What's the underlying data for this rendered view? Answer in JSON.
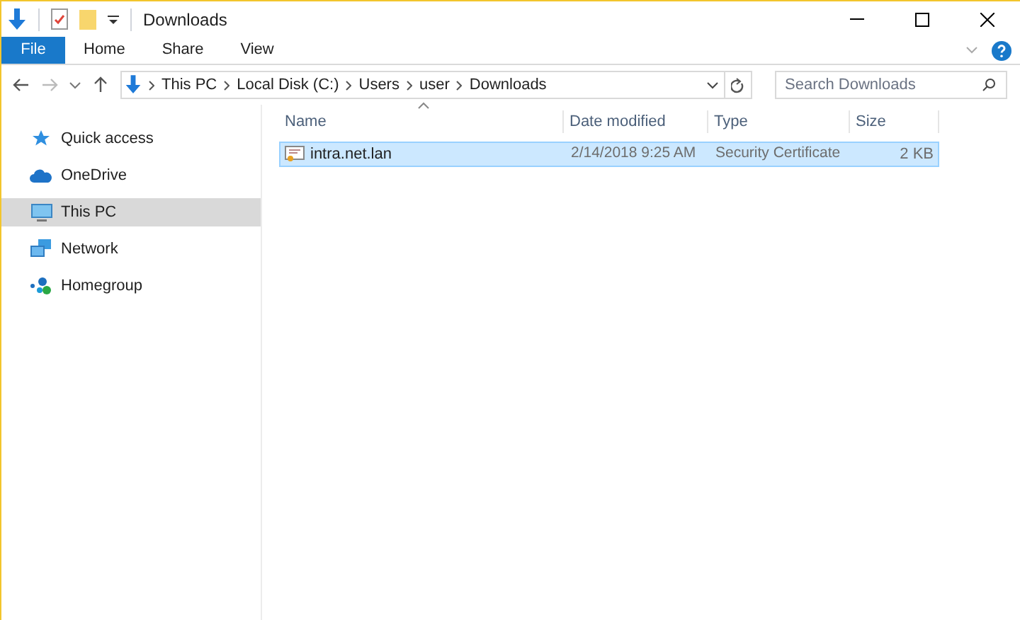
{
  "window": {
    "title": "Downloads"
  },
  "ribbon_tabs": [
    {
      "label": "File",
      "kind": "file"
    },
    {
      "label": "Home",
      "kind": "tab"
    },
    {
      "label": "Share",
      "kind": "tab"
    },
    {
      "label": "View",
      "kind": "tab"
    }
  ],
  "address_bar": {
    "path": [
      "This PC",
      "Local Disk (C:)",
      "Users",
      "user",
      "Downloads"
    ]
  },
  "search": {
    "placeholder": "Search Downloads"
  },
  "sidebar": {
    "items": [
      {
        "label": "Quick access",
        "kind": "star",
        "selected": false
      },
      {
        "label": "OneDrive",
        "kind": "cloud",
        "selected": false
      },
      {
        "label": "This PC",
        "kind": "pc",
        "selected": true
      },
      {
        "label": "Network",
        "kind": "network",
        "selected": false
      },
      {
        "label": "Homegroup",
        "kind": "homegroup",
        "selected": false
      }
    ]
  },
  "table": {
    "columns": [
      "Name",
      "Date modified",
      "Type",
      "Size"
    ],
    "rows": [
      {
        "name": "intra.net.lan",
        "date": "2/14/2018 9:25 AM",
        "type": "Security Certificate",
        "size": "2 KB",
        "selected": true
      }
    ]
  }
}
